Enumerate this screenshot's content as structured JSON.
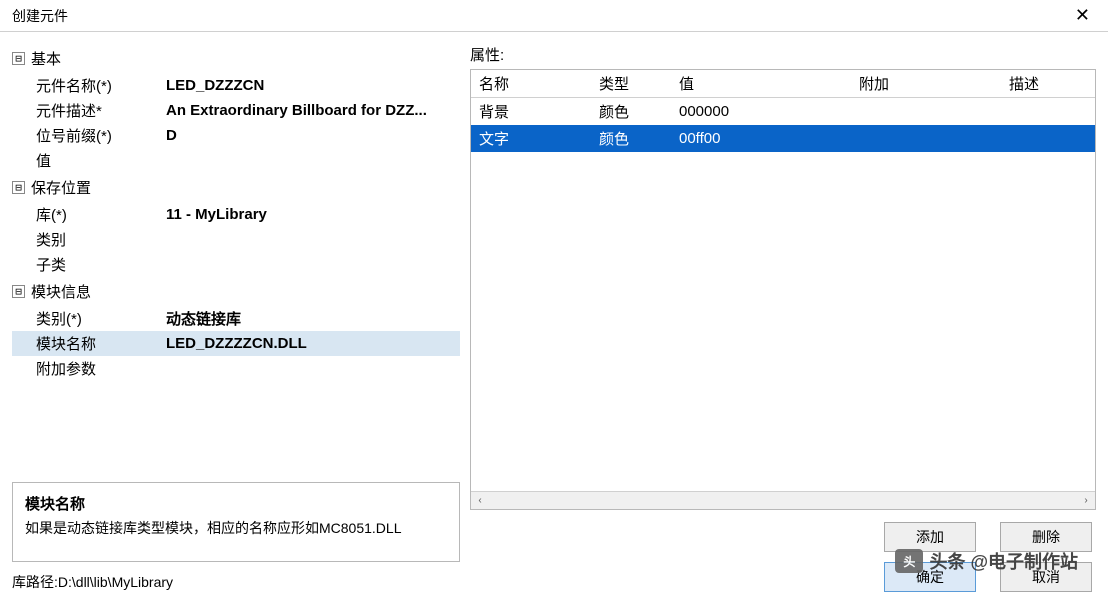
{
  "window": {
    "title": "创建元件"
  },
  "left": {
    "groups": [
      {
        "label": "基本",
        "rows": [
          {
            "label": "元件名称(*)",
            "value": "LED_DZZZCN"
          },
          {
            "label": "元件描述*",
            "value": "An Extraordinary Billboard for DZZ..."
          },
          {
            "label": "位号前缀(*)",
            "value": "D"
          },
          {
            "label": "值",
            "value": ""
          }
        ]
      },
      {
        "label": "保存位置",
        "rows": [
          {
            "label": "库(*)",
            "value": "11 - MyLibrary"
          },
          {
            "label": "类别",
            "value": ""
          },
          {
            "label": "子类",
            "value": ""
          }
        ]
      },
      {
        "label": "模块信息",
        "rows": [
          {
            "label": "类别(*)",
            "value": "动态链接库"
          },
          {
            "label": "模块名称",
            "value": "LED_DZZZZCN.DLL",
            "selected": true
          },
          {
            "label": "附加参数",
            "value": ""
          }
        ]
      }
    ],
    "help": {
      "title": "模块名称",
      "body": "如果是动态链接库类型模块，相应的名称应形如MC8051.DLL"
    },
    "path": "库路径:D:\\dll\\lib\\MyLibrary"
  },
  "right": {
    "section": "属性:",
    "columns": {
      "name": "名称",
      "type": "类型",
      "value": "值",
      "extra": "附加",
      "desc": "描述"
    },
    "rows": [
      {
        "name": "背景",
        "type": "颜色",
        "value": "000000",
        "extra": "",
        "desc": "",
        "selected": false
      },
      {
        "name": "文字",
        "type": "颜色",
        "value": "00ff00",
        "extra": "",
        "desc": "",
        "selected": true
      }
    ],
    "buttons": {
      "add": "添加",
      "delete": "删除"
    }
  },
  "footer": {
    "ok": "确定",
    "cancel": "取消"
  },
  "watermark": {
    "text": "头条 @电子制作站"
  },
  "icons": {
    "expand": "⊟",
    "close": "✕",
    "left": "‹",
    "right": "›"
  }
}
